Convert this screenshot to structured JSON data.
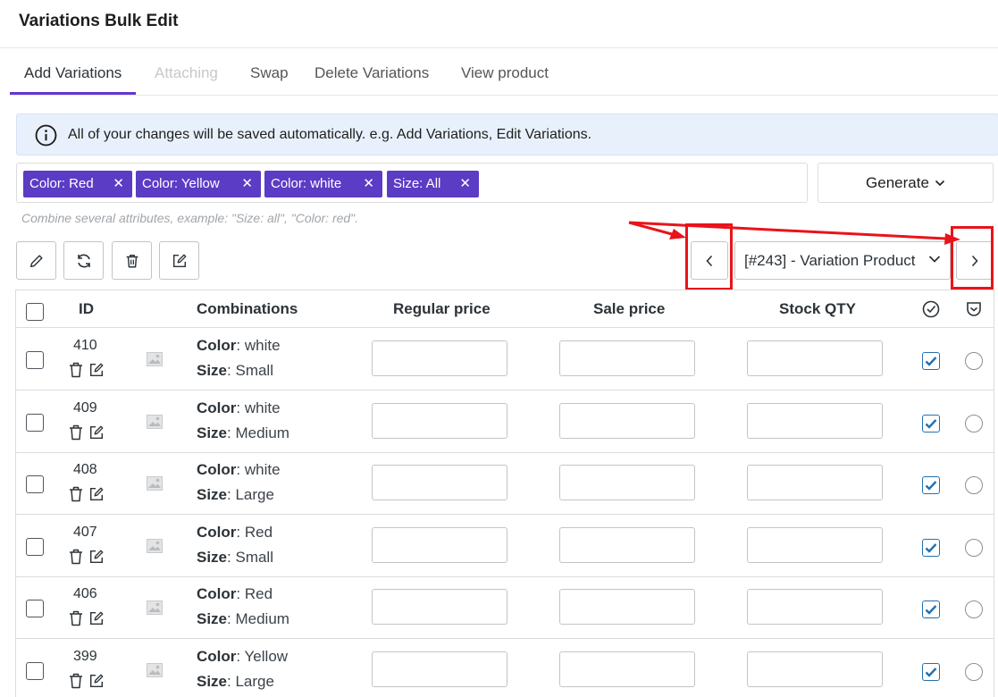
{
  "header": {
    "title": "Variations Bulk Edit"
  },
  "tabs": [
    {
      "label": "Add Variations",
      "state": "active"
    },
    {
      "label": "Attaching",
      "state": "disabled"
    },
    {
      "label": "Swap",
      "state": "normal"
    },
    {
      "label": "Delete Variations",
      "state": "normal"
    },
    {
      "label": "View product",
      "state": "normal"
    }
  ],
  "notice": {
    "text": "All of your changes will be saved automatically. e.g. Add Variations, Edit Variations."
  },
  "attributes": [
    {
      "label": "Color: Red"
    },
    {
      "label": "Color: Yellow"
    },
    {
      "label": "Color: white"
    },
    {
      "label": "Size: All"
    }
  ],
  "generate": {
    "label": "Generate"
  },
  "hint": "Combine several attributes, example: \"Size: all\", \"Color: red\".",
  "product_select": {
    "value": "[#243] - Variation Product"
  },
  "table": {
    "headers": {
      "id": "ID",
      "combinations": "Combinations",
      "regular_price": "Regular price",
      "sale_price": "Sale price",
      "stock_qty": "Stock QTY"
    },
    "rows": [
      {
        "id": "410",
        "color_label": "Color",
        "color": ": white",
        "size_label": "Size",
        "size": ": Small"
      },
      {
        "id": "409",
        "color_label": "Color",
        "color": ": white",
        "size_label": "Size",
        "size": ": Medium"
      },
      {
        "id": "408",
        "color_label": "Color",
        "color": ": white",
        "size_label": "Size",
        "size": ": Large"
      },
      {
        "id": "407",
        "color_label": "Color",
        "color": ": Red",
        "size_label": "Size",
        "size": ": Small"
      },
      {
        "id": "406",
        "color_label": "Color",
        "color": ": Red",
        "size_label": "Size",
        "size": ": Medium"
      },
      {
        "id": "399",
        "color_label": "Color",
        "color": ": Yellow",
        "size_label": "Size",
        "size": ": Large"
      }
    ]
  },
  "colors": {
    "accent": "#5b3cc4",
    "annotation": "#e8141a",
    "checkbox": "#2271b1"
  }
}
